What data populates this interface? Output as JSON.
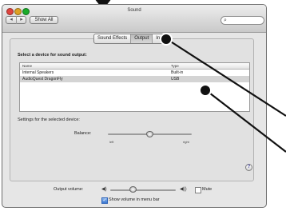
{
  "window": {
    "title": "Sound",
    "nav": {
      "back": "◂",
      "forward": "▸"
    },
    "show_all_label": "Show All",
    "search": {
      "icon": "search-icon",
      "glyph": "🔍",
      "placeholder": ""
    }
  },
  "tabs": [
    {
      "label": "Sound Effects",
      "active": false
    },
    {
      "label": "Output",
      "active": true
    },
    {
      "label": "Input",
      "active": false
    }
  ],
  "output": {
    "heading": "Select a device for sound output:",
    "columns": [
      "Name",
      "Type"
    ],
    "devices": [
      {
        "name": "Internal Speakers",
        "type": "Built-in",
        "selected": false
      },
      {
        "name": "AudioQuest DragonFly",
        "type": "USB",
        "selected": true
      }
    ],
    "settings_label": "Settings for the selected device:",
    "balance": {
      "label": "Balance:",
      "left": "left",
      "right": "right",
      "value": 0.5
    }
  },
  "help": {
    "glyph": "?"
  },
  "footer": {
    "output_volume_label": "Output volume:",
    "volume_low_icon": "speaker-low-icon",
    "volume_low_glyph": "◀)",
    "volume_high_icon": "speaker-high-icon",
    "volume_high_glyph": "◀))",
    "volume_level": 0.35,
    "mute_label": "Mute",
    "mute_checked": false,
    "show_volume_label": "Show volume in menu bar",
    "show_volume_checked": true,
    "check_glyph": "✓"
  },
  "colors": {
    "selected_row": "#d4d4d4",
    "close": "#e0443e",
    "minimize": "#dea123",
    "zoom": "#1aab29",
    "annotation": "#111111"
  }
}
